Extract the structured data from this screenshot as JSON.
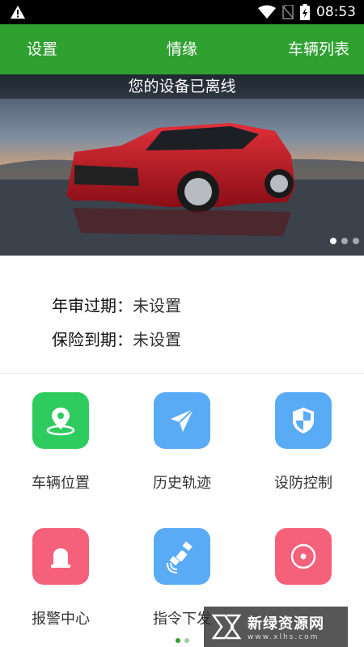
{
  "status_bar": {
    "time": "08:53",
    "icons": [
      "warning-icon",
      "wifi-icon",
      "no-sim-icon",
      "battery-icon"
    ]
  },
  "nav": {
    "left": "设置",
    "center": "情缘",
    "right": "车辆列表"
  },
  "banner": {
    "caption": "您的设备已离线",
    "slides": 3,
    "active_slide": 1
  },
  "info": {
    "annual_label": "年审过期：",
    "annual_value": "未设置",
    "insurance_label": "保险到期：",
    "insurance_value": "未设置"
  },
  "grid": {
    "items": [
      {
        "label": "车辆位置",
        "icon": "location-pin-icon",
        "color": "#2ecc5e"
      },
      {
        "label": "历史轨迹",
        "icon": "paper-plane-icon",
        "color": "#5aabf5"
      },
      {
        "label": "设防控制",
        "icon": "shield-icon",
        "color": "#5aabf5"
      },
      {
        "label": "报警中心",
        "icon": "alarm-light-icon",
        "color": "#f5607a"
      },
      {
        "label": "指令下发",
        "icon": "satellite-icon",
        "color": "#5aabf5"
      },
      {
        "label": "",
        "icon": "record-icon",
        "color": "#f5607a"
      }
    ]
  },
  "pager": {
    "pages": 2,
    "active": 1
  },
  "watermark": {
    "title": "新绿资源网",
    "url": "www.xlhs.com"
  },
  "colors": {
    "nav_green": "#2fa131"
  }
}
